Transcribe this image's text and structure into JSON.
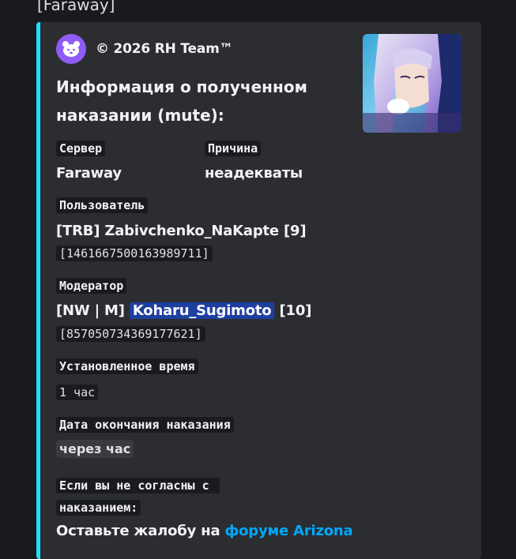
{
  "header_text": "[Faraway]",
  "embed": {
    "author": "© 2026 RH Team™",
    "title": "Информация о полученном наказании (mute):",
    "accent_color": "#1fe0ff",
    "fields": {
      "server_label": "Сервер",
      "server_value": "Faraway",
      "reason_label": "Причина",
      "reason_value": "неадекваты",
      "user_label": "Пользователь",
      "user_value": "[TRB] Zabivchenko_NaKapte [9]",
      "user_id": "[1461667500163989711]",
      "moderator_label": "Модератор",
      "moderator_prefix": "[NW | M]",
      "moderator_mention": "Koharu_Sugimoto",
      "moderator_suffix": "[10]",
      "moderator_id": "[857050734369177621]",
      "duration_label": "Установленное время",
      "duration_value": "1 час",
      "end_label": "Дата окончания наказания",
      "end_value": "через час",
      "appeal_label_1": "Если вы не согласны с ",
      "appeal_label_2": "наказанием:",
      "appeal_text": "Оставьте жалобу на ",
      "appeal_link": "форуме Arizona"
    }
  },
  "icons": {
    "author_icon": "bear-logo-icon",
    "thumbnail": "anime-avatar-image"
  }
}
